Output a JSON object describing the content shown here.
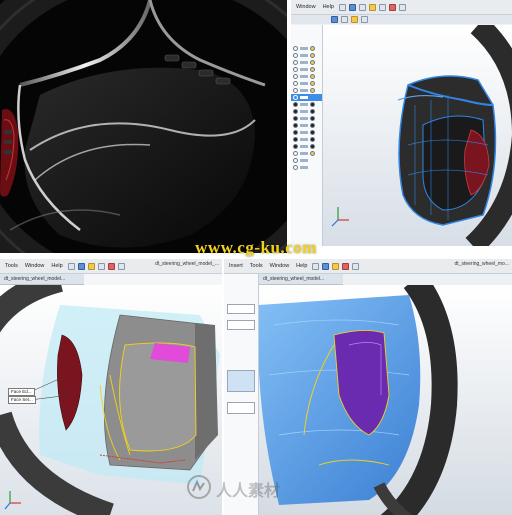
{
  "panels": {
    "top_right": {
      "menu": [
        "Window",
        "Help"
      ],
      "triad_axes": [
        "X",
        "Y",
        "Z"
      ]
    },
    "bottom_left": {
      "menu": [
        "Tools",
        "Window",
        "Help"
      ],
      "doc_title": "dt_steering_wheel_model_...",
      "tab_title": "dt_steering_wheel_model...",
      "callouts": [
        "Face Ed...",
        "Face Set..."
      ],
      "triad_axes": [
        "X",
        "Y",
        "Z"
      ]
    },
    "bottom_right": {
      "menu": [
        "Insert",
        "Tools",
        "Window",
        "Help"
      ],
      "doc_title": "dt_steering_wheel_mo...",
      "tab_title": "dt_steering_wheel_model..."
    }
  },
  "watermark": {
    "url": "www.cg-ku.com",
    "site_name": "人人素材"
  },
  "colors": {
    "highlight_yellow": "#f2d21c",
    "face_maroon": "#7a1520",
    "face_magenta": "#e24ad9",
    "wheel_blue": "#2f86e6",
    "tree_selection": "#3a8ee6"
  }
}
